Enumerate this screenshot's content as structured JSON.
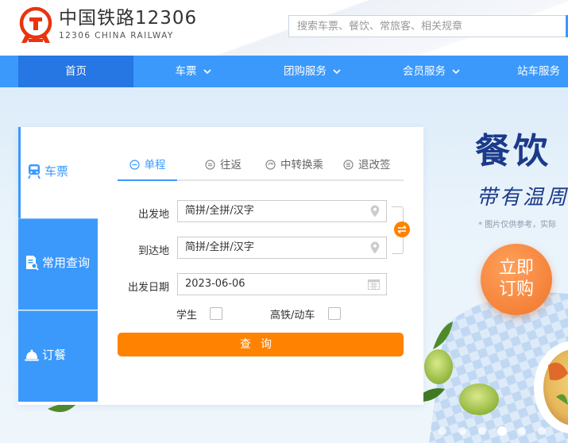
{
  "brand": {
    "name_cn": "中国铁路12306",
    "name_en": "12306 CHINA RAILWAY"
  },
  "colors": {
    "primary": "#3b99fc",
    "nav_active": "#2676e3",
    "accent": "#ff8200",
    "logo_red": "#e8340f",
    "promo_navy": "#1c3a8a"
  },
  "search": {
    "placeholder": "搜索车票、餐饮、常旅客、相关规章",
    "value": ""
  },
  "nav": [
    {
      "label": "首页",
      "active": true,
      "dropdown": false
    },
    {
      "label": "车票",
      "active": false,
      "dropdown": true
    },
    {
      "label": "团购服务",
      "active": false,
      "dropdown": true
    },
    {
      "label": "会员服务",
      "active": false,
      "dropdown": true
    },
    {
      "label": "站车服务",
      "active": false,
      "dropdown": false
    }
  ],
  "side_tabs": [
    {
      "label": "车票",
      "icon": "train-icon",
      "active": true
    },
    {
      "label": "常用查询",
      "icon": "document-search-icon",
      "active": false
    },
    {
      "label": "订餐",
      "icon": "meal-cloche-icon",
      "active": false
    }
  ],
  "trip_tabs": [
    {
      "label": "单程",
      "icon": "minus-circle-icon",
      "active": true
    },
    {
      "label": "往返",
      "icon": "equals-circle-icon",
      "active": false
    },
    {
      "label": "中转换乘",
      "icon": "transfer-circle-icon",
      "active": false
    },
    {
      "label": "退改签",
      "icon": "list-circle-icon",
      "active": false
    }
  ],
  "form": {
    "from_label": "出发地",
    "from_value": "简拼/全拼/汉字",
    "from_icon": "location-pin-icon",
    "to_label": "到达地",
    "to_value": "简拼/全拼/汉字",
    "to_icon": "location-pin-icon",
    "date_label": "出发日期",
    "date_value": "2023-06-06",
    "date_icon": "calendar-icon",
    "swap_icon": "swap-icon",
    "student_label": "学生",
    "student_checked": false,
    "highspeed_label": "高铁/动车",
    "highspeed_checked": false,
    "query_label": "查询"
  },
  "promo": {
    "title": "餐饮",
    "subtitle": "带有温周",
    "note": "* 图片仅供参考，实际",
    "button_line1": "立即",
    "button_line2": "订购",
    "carousel_count": 7,
    "carousel_active_index": 4
  }
}
